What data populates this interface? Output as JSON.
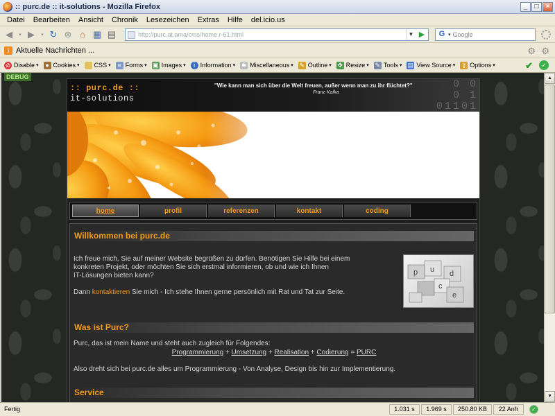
{
  "window": {
    "title": ":: purc.de :: it-solutions - Mozilla Firefox"
  },
  "menu": [
    "Datei",
    "Bearbeiten",
    "Ansicht",
    "Chronik",
    "Lesezeichen",
    "Extras",
    "Hilfe",
    "del.icio.us"
  ],
  "nav": {
    "url": "http://purc.at.ama/cms/home.r-61.html",
    "search_placeholder": "Google"
  },
  "bookmarks": {
    "feed_label": "Aktuelle Nachrichten ..."
  },
  "devtoolbar": {
    "items": [
      "Disable",
      "Cookies",
      "CSS",
      "Forms",
      "Images",
      "Information",
      "Miscellaneous",
      "Outline",
      "Resize",
      "Tools",
      "View Source",
      "Options"
    ]
  },
  "page": {
    "debug": "DEBUG",
    "logo_top": ":: purc.de ::",
    "logo_bottom": "it-solutions",
    "quote": "\"Wie kann man sich über die Welt freuen, außer wenn man zu ihr flüchtet?\"",
    "quote_author": "Franz Kafka",
    "binary": "0 0\n0 1\n01101",
    "tabs": [
      "home",
      "profil",
      "referenzen",
      "kontakt",
      "coding"
    ],
    "welcome_heading": "Willkommen bei purc.de",
    "welcome_text_1": "Ich freue mich, Sie auf meiner Website begrüßen zu dürfen. Benötigen Sie Hilfe bei einem",
    "welcome_text_2": "konkreten Projekt, oder möchten Sie sich erstmal informieren, ob und wie ich Ihnen",
    "welcome_text_3": "IT-Lösungen bieten kann?",
    "contact_prefix": "Dann ",
    "contact_link": "kontaktieren",
    "contact_suffix": " Sie mich - Ich stehe Ihnen gerne persönlich mit Rat und Tat zur Seite.",
    "puzzle_letters": [
      "p",
      "u",
      "d",
      "c",
      "e"
    ],
    "what_heading": "Was ist Purc?",
    "what_text": "Purc, das ist mein Name und steht auch zugleich für Folgendes:",
    "acronym": [
      "Programmierung",
      "Umsetzung",
      "Realisation",
      "Codierung",
      "PURC"
    ],
    "summary": "Also dreht sich bei purc.de alles um Programmierung - Von Analyse, Design bis hin zur Implementierung.",
    "service_heading": "Service"
  },
  "status": {
    "message": "Fertig",
    "time1": "1.031 s",
    "time2": "1.969 s",
    "size": "250.80 KB",
    "requests": "22 Anfr"
  }
}
